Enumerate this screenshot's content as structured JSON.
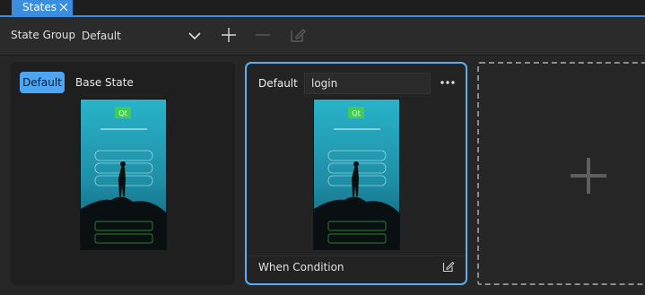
{
  "tab": {
    "label": "States",
    "close_icon": "close-icon"
  },
  "toolbar": {
    "state_group_label": "State Group",
    "state_group_value": "Default",
    "icons": [
      "chevron-down-icon",
      "plus-icon",
      "minus-icon",
      "edit-icon"
    ]
  },
  "base_state": {
    "badge": "Default",
    "label": "Base State",
    "thumb_logo": "Qt"
  },
  "state_card": {
    "title": "Default",
    "name": "login",
    "when_condition": "When Condition",
    "thumb_logo": "Qt"
  },
  "add_state": {
    "icon": "plus-icon"
  },
  "colors": {
    "accent": "#4ea5f2",
    "background": "#262626",
    "panel": "#1f1f1f"
  }
}
